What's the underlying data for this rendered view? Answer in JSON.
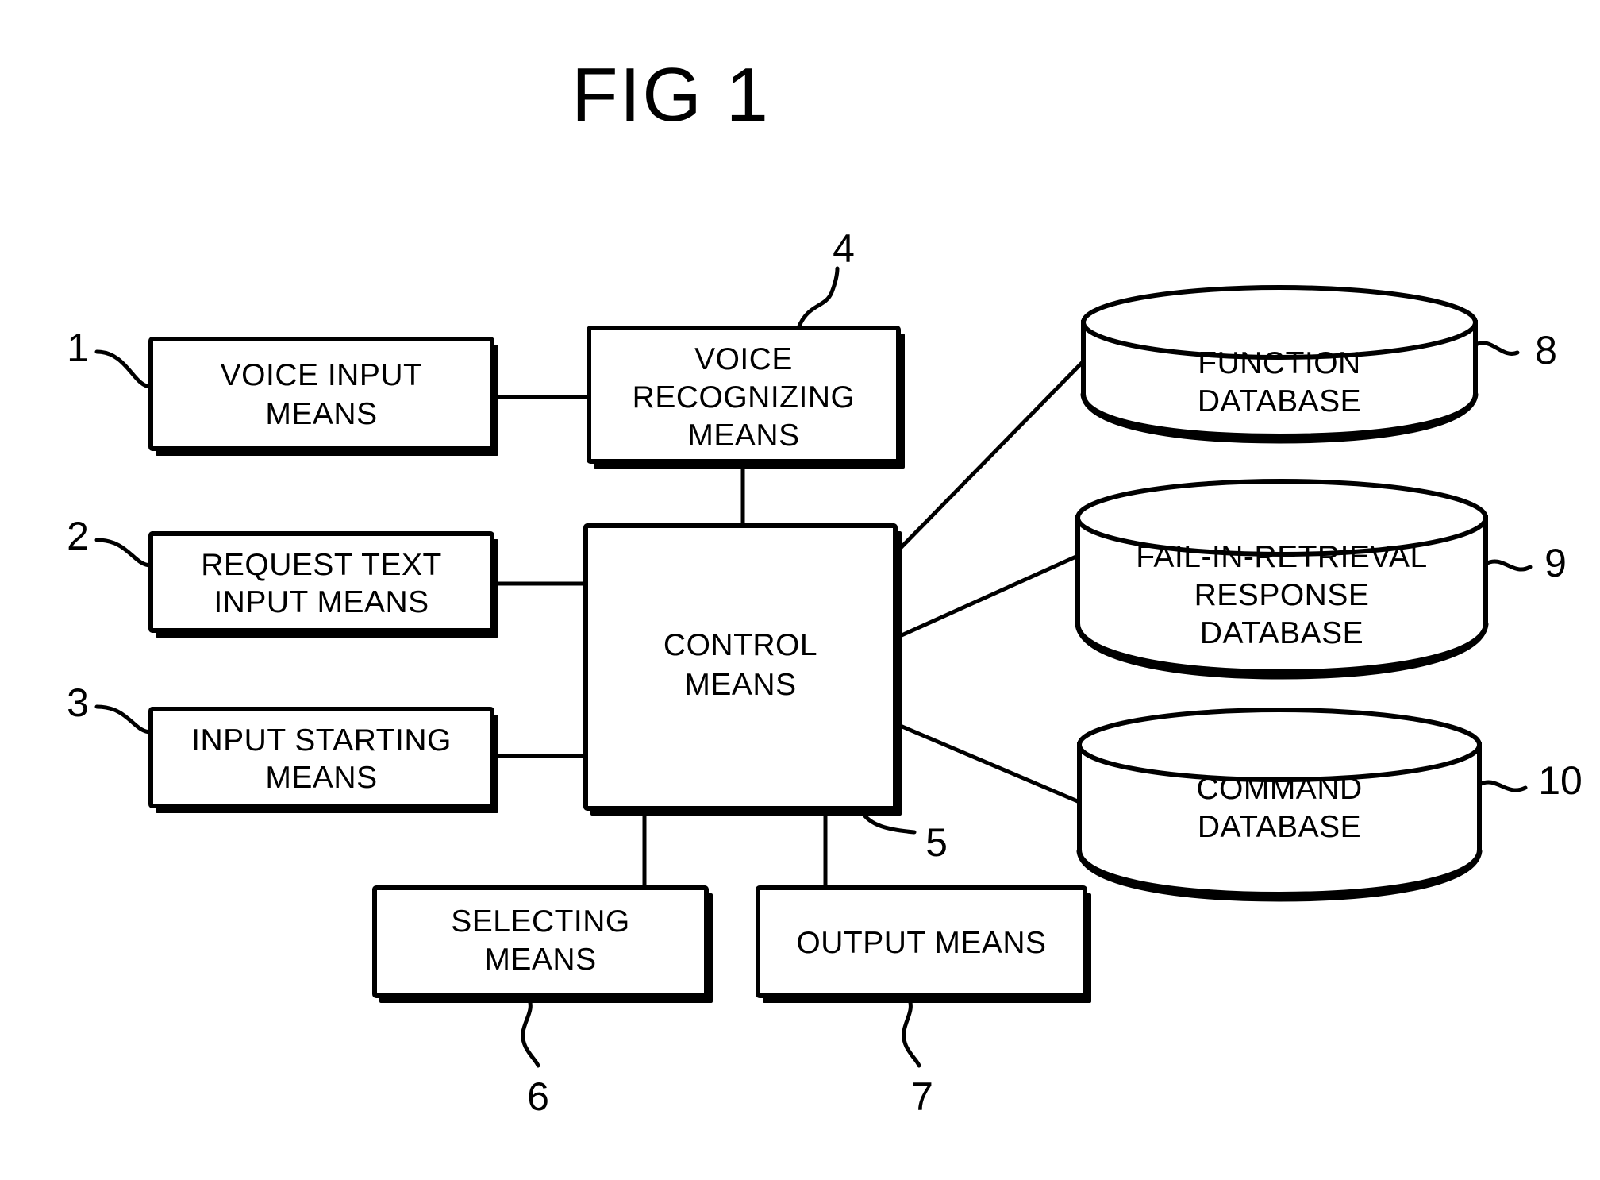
{
  "figure": {
    "title": "FIG 1",
    "type": "patent-block-diagram"
  },
  "nodes": {
    "voice_input": {
      "ref": "1",
      "label_line1": "VOICE INPUT",
      "label_line2": "MEANS",
      "shape": "rect"
    },
    "request_text_input": {
      "ref": "2",
      "label_line1": "REQUEST TEXT",
      "label_line2": "INPUT MEANS",
      "shape": "rect"
    },
    "input_starting": {
      "ref": "3",
      "label_line1": "INPUT STARTING",
      "label_line2": "MEANS",
      "shape": "rect"
    },
    "voice_recognizing": {
      "ref": "4",
      "label_line1": "VOICE",
      "label_line2": "RECOGNIZING",
      "label_line3": "MEANS",
      "shape": "rect"
    },
    "control": {
      "ref": "5",
      "label_line1": "CONTROL",
      "label_line2": "MEANS",
      "shape": "rect"
    },
    "selecting": {
      "ref": "6",
      "label_line1": "SELECTING",
      "label_line2": "MEANS",
      "shape": "rect"
    },
    "output": {
      "ref": "7",
      "label_line1": "OUTPUT MEANS",
      "shape": "rect"
    },
    "function_db": {
      "ref": "8",
      "label_line1": "FUNCTION",
      "label_line2": "DATABASE",
      "shape": "cylinder"
    },
    "fail_in_retrieval_db": {
      "ref": "9",
      "label_line1": "FAIL-IN-RETRIEVAL",
      "label_line2": "RESPONSE",
      "label_line3": "DATABASE",
      "shape": "cylinder"
    },
    "command_db": {
      "ref": "10",
      "label_line1": "COMMAND",
      "label_line2": "DATABASE",
      "shape": "cylinder"
    }
  },
  "connections": [
    {
      "from": "voice_input",
      "to": "voice_recognizing"
    },
    {
      "from": "voice_recognizing",
      "to": "control"
    },
    {
      "from": "request_text_input",
      "to": "control"
    },
    {
      "from": "input_starting",
      "to": "control"
    },
    {
      "from": "control",
      "to": "function_db"
    },
    {
      "from": "control",
      "to": "fail_in_retrieval_db"
    },
    {
      "from": "control",
      "to": "command_db"
    },
    {
      "from": "control",
      "to": "selecting"
    },
    {
      "from": "control",
      "to": "output"
    }
  ],
  "colors": {
    "ink": "#000000",
    "paper": "#ffffff"
  }
}
